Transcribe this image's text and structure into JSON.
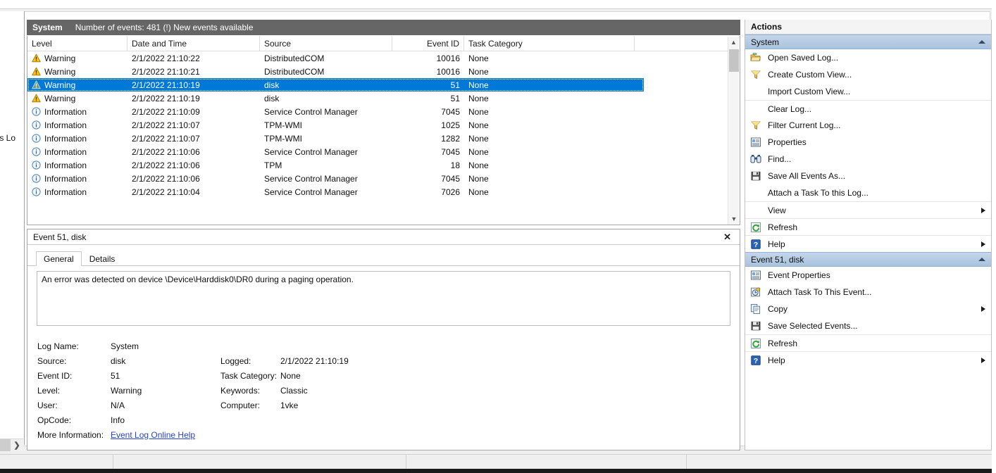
{
  "window": {
    "tree_pane_truncated_label": "ices Lo"
  },
  "log_header": {
    "log_name": "System",
    "status": "Number of events: 481 (!) New events available"
  },
  "events": {
    "columns": [
      "Level",
      "Date and Time",
      "Source",
      "Event ID",
      "Task Category"
    ],
    "rows": [
      {
        "icon": "warning-icon",
        "level": "Warning",
        "date": "2/1/2022 21:10:22",
        "source": "DistributedCOM",
        "event_id": "10016",
        "task": "None",
        "selected": false
      },
      {
        "icon": "warning-icon",
        "level": "Warning",
        "date": "2/1/2022 21:10:21",
        "source": "DistributedCOM",
        "event_id": "10016",
        "task": "None",
        "selected": false
      },
      {
        "icon": "warning-icon",
        "level": "Warning",
        "date": "2/1/2022 21:10:19",
        "source": "disk",
        "event_id": "51",
        "task": "None",
        "selected": true
      },
      {
        "icon": "warning-icon",
        "level": "Warning",
        "date": "2/1/2022 21:10:19",
        "source": "disk",
        "event_id": "51",
        "task": "None",
        "selected": false
      },
      {
        "icon": "information-icon",
        "level": "Information",
        "date": "2/1/2022 21:10:09",
        "source": "Service Control Manager",
        "event_id": "7045",
        "task": "None",
        "selected": false
      },
      {
        "icon": "information-icon",
        "level": "Information",
        "date": "2/1/2022 21:10:07",
        "source": "TPM-WMI",
        "event_id": "1025",
        "task": "None",
        "selected": false
      },
      {
        "icon": "information-icon",
        "level": "Information",
        "date": "2/1/2022 21:10:07",
        "source": "TPM-WMI",
        "event_id": "1282",
        "task": "None",
        "selected": false
      },
      {
        "icon": "information-icon",
        "level": "Information",
        "date": "2/1/2022 21:10:06",
        "source": "Service Control Manager",
        "event_id": "7045",
        "task": "None",
        "selected": false
      },
      {
        "icon": "information-icon",
        "level": "Information",
        "date": "2/1/2022 21:10:06",
        "source": "TPM",
        "event_id": "18",
        "task": "None",
        "selected": false
      },
      {
        "icon": "information-icon",
        "level": "Information",
        "date": "2/1/2022 21:10:06",
        "source": "Service Control Manager",
        "event_id": "7045",
        "task": "None",
        "selected": false
      },
      {
        "icon": "information-icon",
        "level": "Information",
        "date": "2/1/2022 21:10:04",
        "source": "Service Control Manager",
        "event_id": "7026",
        "task": "None",
        "selected": false
      }
    ]
  },
  "detail": {
    "title": "Event 51, disk",
    "close_label": "✕",
    "tabs": [
      {
        "label": "General",
        "active": true
      },
      {
        "label": "Details",
        "active": false
      }
    ],
    "message": "An error was detected on device \\Device\\Harddisk0\\DR0 during a paging operation.",
    "properties": {
      "log_name_label": "Log Name:",
      "log_name_value": "System",
      "source_label": "Source:",
      "source_value": "disk",
      "logged_label": "Logged:",
      "logged_value": "2/1/2022 21:10:19",
      "event_id_label": "Event ID:",
      "event_id_value": "51",
      "task_category_label": "Task Category:",
      "task_category_value": "None",
      "level_label": "Level:",
      "level_value": "Warning",
      "keywords_label": "Keywords:",
      "keywords_value": "Classic",
      "user_label": "User:",
      "user_value": "N/A",
      "computer_label": "Computer:",
      "computer_value": "1vke",
      "opcode_label": "OpCode:",
      "opcode_value": "Info",
      "more_info_label": "More Information:",
      "more_info_link": "Event Log Online Help"
    }
  },
  "actions": {
    "title": "Actions",
    "groups": [
      {
        "header": "System",
        "items": [
          {
            "label": "Open Saved Log...",
            "icon": "open-folder-icon",
            "submenu": false,
            "separator": false
          },
          {
            "label": "Create Custom View...",
            "icon": "filter-icon",
            "submenu": false,
            "separator": false
          },
          {
            "label": "Import Custom View...",
            "icon": "none",
            "submenu": false,
            "separator": false
          },
          {
            "label": "Clear Log...",
            "icon": "none",
            "submenu": false,
            "separator": true
          },
          {
            "label": "Filter Current Log...",
            "icon": "filter-icon",
            "submenu": false,
            "separator": false
          },
          {
            "label": "Properties",
            "icon": "properties-icon",
            "submenu": false,
            "separator": false
          },
          {
            "label": "Find...",
            "icon": "binoculars-icon",
            "submenu": false,
            "separator": false
          },
          {
            "label": "Save All Events As...",
            "icon": "save-icon",
            "submenu": false,
            "separator": false
          },
          {
            "label": "Attach a Task To this Log...",
            "icon": "none",
            "submenu": false,
            "separator": false
          },
          {
            "label": "View",
            "icon": "none",
            "submenu": true,
            "separator": true
          },
          {
            "label": "Refresh",
            "icon": "refresh-icon",
            "submenu": false,
            "separator": true
          },
          {
            "label": "Help",
            "icon": "help-icon",
            "submenu": true,
            "separator": true
          }
        ]
      },
      {
        "header": "Event 51, disk",
        "items": [
          {
            "label": "Event Properties",
            "icon": "properties-icon",
            "submenu": false,
            "separator": false
          },
          {
            "label": "Attach Task To This Event...",
            "icon": "clock-task-icon",
            "submenu": false,
            "separator": false
          },
          {
            "label": "Copy",
            "icon": "copy-icon",
            "submenu": true,
            "separator": false
          },
          {
            "label": "Save Selected Events...",
            "icon": "save-icon",
            "submenu": false,
            "separator": false
          },
          {
            "label": "Refresh",
            "icon": "refresh-icon",
            "submenu": false,
            "separator": true
          },
          {
            "label": "Help",
            "icon": "help-icon",
            "submenu": true,
            "separator": true
          }
        ]
      }
    ]
  },
  "colors": {
    "header_bar": "#666666",
    "selection": "#0078d7",
    "group_header": "#a9c2dd",
    "warning": "#ffc20e",
    "information": "#5a8fbe",
    "link": "#2a43c8"
  }
}
